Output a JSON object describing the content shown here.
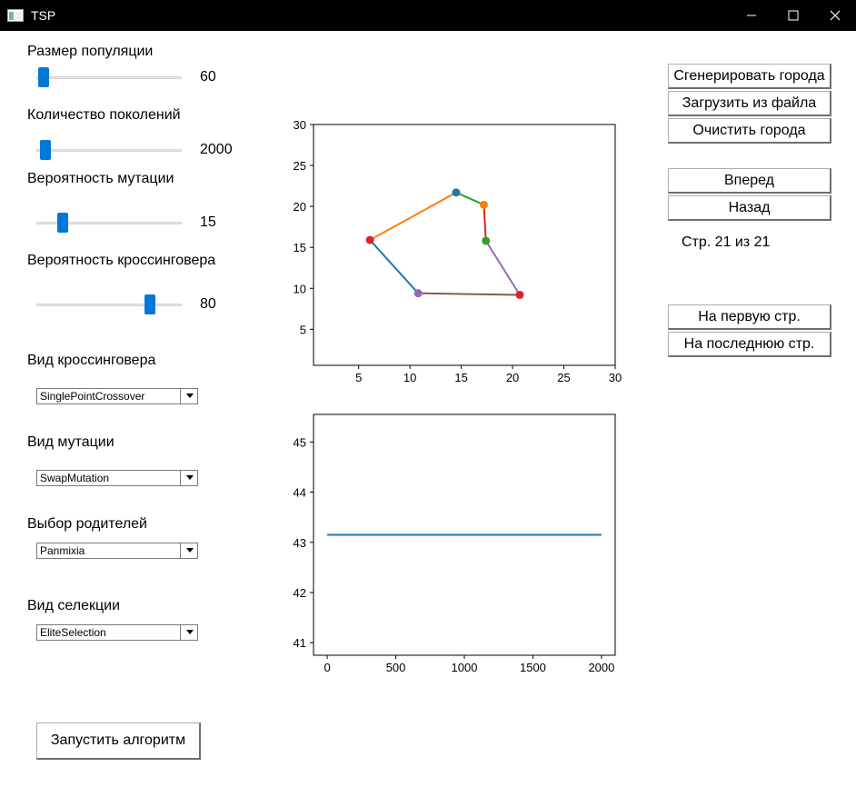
{
  "window": {
    "title": "TSP",
    "icons": {
      "app": "app-icon",
      "minimize": "minimize-icon",
      "maximize": "maximize-icon",
      "close": "close-icon"
    }
  },
  "params": {
    "population": {
      "label": "Размер популяции",
      "value": "60",
      "slider_fraction": 0.05
    },
    "generations": {
      "label": "Количество поколений",
      "value": "2000",
      "slider_fraction": 0.06
    },
    "mutation": {
      "label": "Вероятность мутации",
      "value": "15",
      "slider_fraction": 0.18
    },
    "crossover": {
      "label": "Вероятность кроссинговера",
      "value": "80",
      "slider_fraction": 0.78
    }
  },
  "selects": {
    "crossover_type": {
      "label": "Вид кроссинговера",
      "value": "SinglePointCrossover"
    },
    "mutation_type": {
      "label": "Вид мутации",
      "value": "SwapMutation"
    },
    "parent_selection": {
      "label": "Выбор родителей",
      "value": "Panmixia"
    },
    "selection_type": {
      "label": "Вид селекции",
      "value": "EliteSelection"
    }
  },
  "buttons": {
    "run": "Запустить алгоритм",
    "generate": "Сгенерировать города",
    "load": "Загрузить из файла",
    "clear": "Очистить города",
    "forward": "Вперед",
    "back": "Назад",
    "first_page": "На первую стр.",
    "last_page": "На последнюю стр."
  },
  "pagination": {
    "text": "Стр. 21 из 21"
  },
  "chart_data": [
    {
      "type": "line",
      "xlim": [
        0.6,
        30
      ],
      "ylim": [
        0.6,
        30
      ],
      "xticks": [
        5,
        10,
        15,
        20,
        25,
        30
      ],
      "yticks": [
        5,
        10,
        15,
        20,
        25,
        30
      ],
      "cities": [
        {
          "x": 6.1,
          "y": 15.9,
          "color": "#d62728"
        },
        {
          "x": 10.8,
          "y": 9.4,
          "color": "#9467bd"
        },
        {
          "x": 14.5,
          "y": 21.7,
          "color": "#1f77b4"
        },
        {
          "x": 17.2,
          "y": 20.2,
          "color": "#ff7f0e"
        },
        {
          "x": 17.4,
          "y": 15.8,
          "color": "#2ca02c"
        },
        {
          "x": 20.7,
          "y": 9.2,
          "color": "#d62728"
        }
      ],
      "series": [
        {
          "color": "#1f77b4",
          "points": [
            [
              6.1,
              15.9
            ],
            [
              10.8,
              9.4
            ]
          ]
        },
        {
          "color": "#ff7f0e",
          "points": [
            [
              6.1,
              15.9
            ],
            [
              14.5,
              21.7
            ]
          ]
        },
        {
          "color": "#2ca02c",
          "points": [
            [
              14.5,
              21.7
            ],
            [
              17.2,
              20.2
            ]
          ]
        },
        {
          "color": "#d62728",
          "points": [
            [
              17.2,
              20.2
            ],
            [
              17.4,
              15.8
            ]
          ]
        },
        {
          "color": "#9467bd",
          "points": [
            [
              17.4,
              15.8
            ],
            [
              20.7,
              9.2
            ]
          ]
        },
        {
          "color": "#8c564b",
          "points": [
            [
              20.7,
              9.2
            ],
            [
              10.8,
              9.4
            ]
          ]
        }
      ]
    },
    {
      "type": "line",
      "xlim": [
        -100,
        2100
      ],
      "ylim": [
        40.75,
        45.55
      ],
      "xticks": [
        0,
        500,
        1000,
        1500,
        2000
      ],
      "yticks": [
        41,
        42,
        43,
        44,
        45
      ],
      "series": [
        {
          "color": "#1f77b4",
          "x": [
            0,
            2000
          ],
          "y": [
            43.15,
            43.15
          ]
        }
      ]
    }
  ]
}
